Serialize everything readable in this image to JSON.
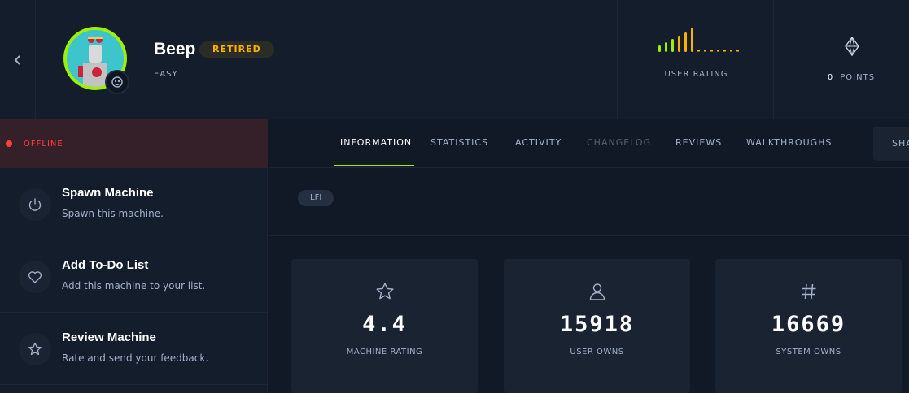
{
  "header": {
    "machine_name": "Beep",
    "status_badge": "RETIRED",
    "difficulty": "EASY",
    "rating_label": "USER RATING",
    "points_value": "0",
    "points_label": "POINTS"
  },
  "sidebar": {
    "status": "OFFLINE",
    "actions": [
      {
        "title": "Spawn Machine",
        "subtitle": "Spawn this machine.",
        "icon": "power-icon"
      },
      {
        "title": "Add To-Do List",
        "subtitle": "Add this machine to your list.",
        "icon": "heart-icon"
      },
      {
        "title": "Review Machine",
        "subtitle": "Rate and send your feedback.",
        "icon": "star-icon"
      }
    ]
  },
  "tabs": {
    "items": [
      "INFORMATION",
      "STATISTICS",
      "ACTIVITY",
      "CHANGELOG",
      "REVIEWS",
      "WALKTHROUGHS"
    ],
    "active": "INFORMATION",
    "share_label": "SHA"
  },
  "tags": [
    "LFI"
  ],
  "stats": [
    {
      "icon": "star-icon",
      "value": "4.4",
      "label": "MACHINE RATING"
    },
    {
      "icon": "user-icon",
      "value": "15918",
      "label": "USER OWNS"
    },
    {
      "icon": "hash-icon",
      "value": "16669",
      "label": "SYSTEM OWNS"
    }
  ],
  "colors": {
    "accent": "#9fef00",
    "retired": "#ffaf00",
    "offline": "#ff3e3e",
    "background": "#111927",
    "panel": "#141d2b",
    "card": "#1a2332"
  }
}
